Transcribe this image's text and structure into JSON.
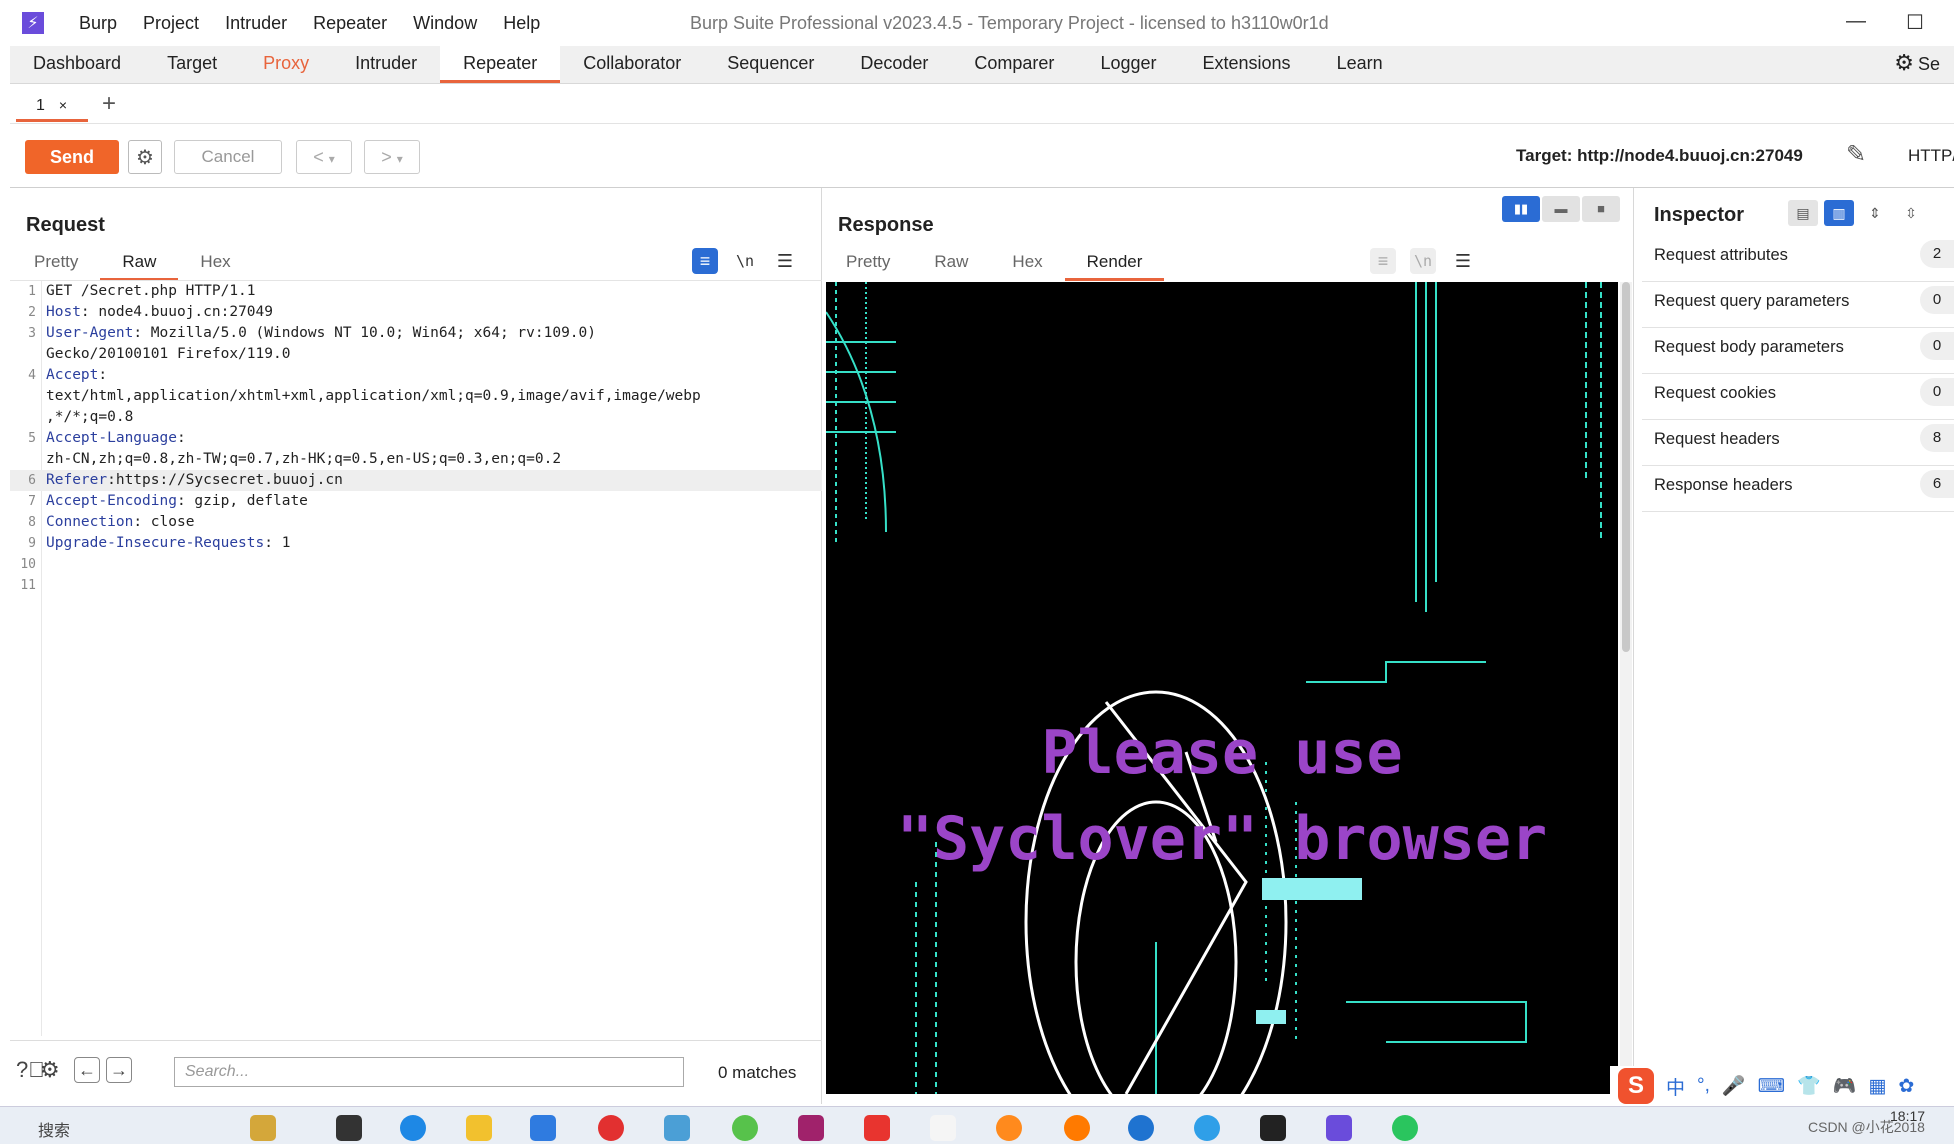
{
  "window": {
    "title": "Burp Suite Professional v2023.4.5 - Temporary Project - licensed to h3110w0r1d",
    "menu": [
      "Burp",
      "Project",
      "Intruder",
      "Repeater",
      "Window",
      "Help"
    ]
  },
  "tool_tabs": [
    "Dashboard",
    "Target",
    "Proxy",
    "Intruder",
    "Repeater",
    "Collaborator",
    "Sequencer",
    "Decoder",
    "Comparer",
    "Logger",
    "Extensions",
    "Learn"
  ],
  "settings_label": "Se",
  "repeater_tab": {
    "label": "1",
    "close": "×"
  },
  "toolbar": {
    "send": "Send",
    "cancel": "Cancel",
    "prev": "<",
    "next": ">",
    "dropdown": "▾",
    "target": "Target: http://node4.buuoj.cn:27049",
    "http_version": "HTTP/"
  },
  "request": {
    "title": "Request",
    "tabs": [
      "Pretty",
      "Raw",
      "Hex"
    ],
    "active_tab": "Raw",
    "lines": [
      {
        "n": "1",
        "name": "",
        "sep": "",
        "value": "GET /Secret.php HTTP/1.1"
      },
      {
        "n": "2",
        "name": "Host",
        "sep": ": ",
        "value": "node4.buuoj.cn:27049"
      },
      {
        "n": "3",
        "name": "User-Agent",
        "sep": ": ",
        "value": "Mozilla/5.0 (Windows NT 10.0; Win64; x64; rv:109.0)"
      },
      {
        "n": "",
        "name": "",
        "sep": "",
        "value": "Gecko/20100101 Firefox/119.0"
      },
      {
        "n": "4",
        "name": "Accept",
        "sep": ":",
        "value": ""
      },
      {
        "n": "",
        "name": "",
        "sep": "",
        "value": "text/html,application/xhtml+xml,application/xml;q=0.9,image/avif,image/webp"
      },
      {
        "n": "",
        "name": "",
        "sep": "",
        "value": ",*/*;q=0.8"
      },
      {
        "n": "5",
        "name": "Accept-Language",
        "sep": ":",
        "value": ""
      },
      {
        "n": "",
        "name": "",
        "sep": "",
        "value": "zh-CN,zh;q=0.8,zh-TW;q=0.7,zh-HK;q=0.5,en-US;q=0.3,en;q=0.2"
      },
      {
        "n": "6",
        "name": "Referer",
        "sep": ":",
        "value": "https://Sycsecret.buuoj.cn"
      },
      {
        "n": "7",
        "name": "Accept-Encoding",
        "sep": ": ",
        "value": "gzip, deflate"
      },
      {
        "n": "8",
        "name": "Connection",
        "sep": ": ",
        "value": "close"
      },
      {
        "n": "9",
        "name": "Upgrade-Insecure-Requests",
        "sep": ": ",
        "value": "1"
      },
      {
        "n": "10",
        "name": "",
        "sep": "",
        "value": ""
      },
      {
        "n": "11",
        "name": "",
        "sep": "",
        "value": ""
      }
    ],
    "highlight_line": 9,
    "search_placeholder": "Search...",
    "matches": "0 matches"
  },
  "response": {
    "title": "Response",
    "tabs": [
      "Pretty",
      "Raw",
      "Hex",
      "Render"
    ],
    "active_tab": "Render",
    "render_line1": "Please use",
    "render_line2": "\"Syclover\" browser"
  },
  "inspector": {
    "title": "Inspector",
    "rows": [
      {
        "label": "Request attributes",
        "count": "2"
      },
      {
        "label": "Request query parameters",
        "count": "0"
      },
      {
        "label": "Request body parameters",
        "count": "0"
      },
      {
        "label": "Request cookies",
        "count": "0"
      },
      {
        "label": "Request headers",
        "count": "8"
      },
      {
        "label": "Response headers",
        "count": "6"
      }
    ]
  },
  "ime": {
    "logo": "S",
    "items": [
      "中",
      "°,",
      "🎤",
      "⌨",
      "👕",
      "🎮",
      "▦",
      "✿"
    ]
  },
  "taskbar": {
    "search": "搜索",
    "watermark": "CSDN @小花2018",
    "clock": "18:17"
  },
  "colors": {
    "accent": "#e8643c",
    "send": "#f06529",
    "blue": "#2b6cd4",
    "render_text": "#9b45c8"
  }
}
